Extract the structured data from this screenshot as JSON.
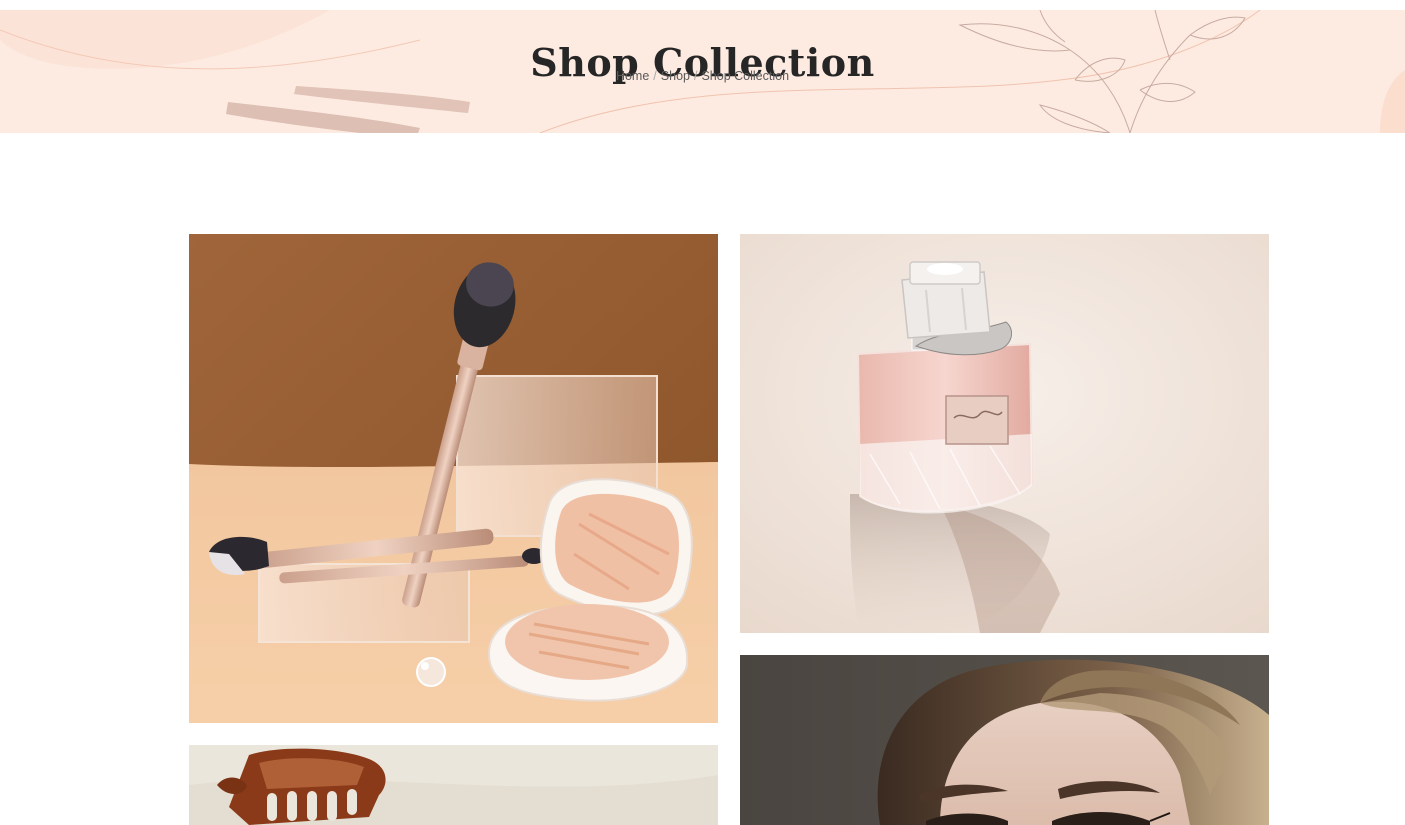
{
  "hero": {
    "title": "Shop Collection",
    "background_color": "#fdebe2",
    "breadcrumb": {
      "items": [
        "Home",
        "Shop"
      ],
      "separator": "/",
      "current": "Shop Collection"
    }
  },
  "gallery": {
    "tiles": [
      {
        "name": "makeup-brushes-compact",
        "icon": "product-photo"
      },
      {
        "name": "perfume-bottle",
        "icon": "product-photo"
      },
      {
        "name": "hair-claw-clip",
        "icon": "product-photo"
      },
      {
        "name": "model-portrait",
        "icon": "product-photo"
      }
    ]
  },
  "colors": {
    "accent_peach": "#fdebe2",
    "title_text": "#262626",
    "breadcrumb_text": "#5a5a5a"
  }
}
